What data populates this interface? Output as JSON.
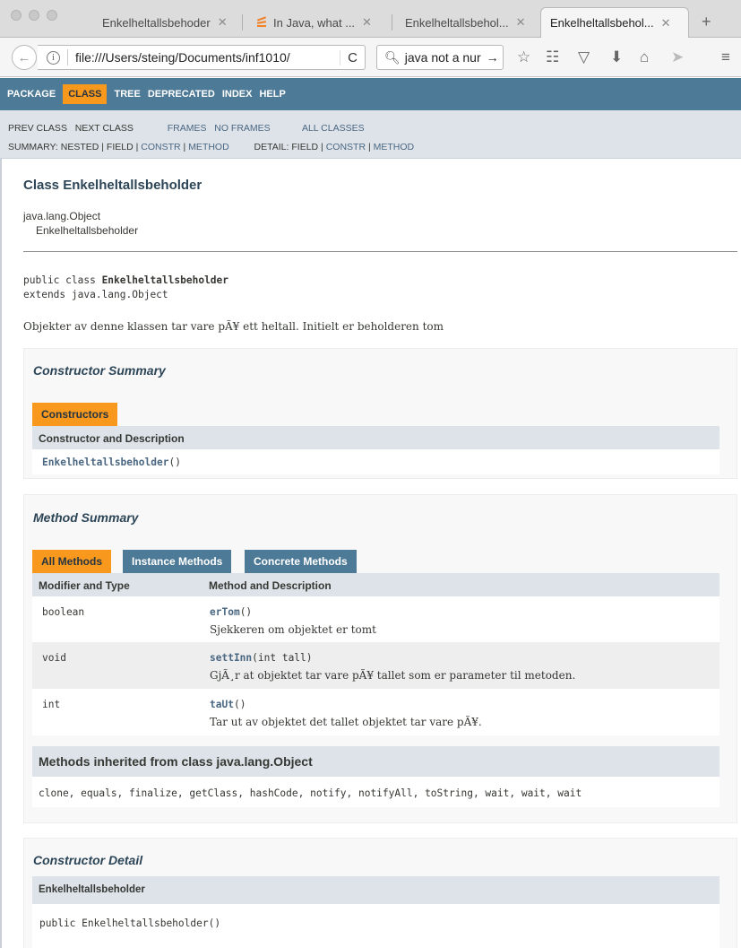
{
  "browser": {
    "tabs": [
      {
        "label": "Enkelheltallsbehoder",
        "close": "✕"
      },
      {
        "label": "In Java, what ...",
        "close": "✕"
      },
      {
        "label": "Enkelheltallsbehol...",
        "close": "✕"
      },
      {
        "label": "Enkelheltallsbehol...",
        "close": "✕"
      }
    ],
    "new_tab": "+",
    "url": "file:///Users/steing/Documents/inf1010/",
    "reload": "C",
    "search_value": "java not a nur",
    "search_go": "→"
  },
  "javadoc": {
    "topnav": [
      "PACKAGE",
      "CLASS",
      "TREE",
      "DEPRECATED",
      "INDEX",
      "HELP"
    ],
    "subnav": {
      "prev_class": "PREV CLASS",
      "next_class": "NEXT CLASS",
      "frames": "FRAMES",
      "no_frames": "NO FRAMES",
      "all_classes": "ALL CLASSES",
      "summary_label": "SUMMARY:",
      "summary_nested": "NESTED",
      "summary_field": "FIELD",
      "summary_constr": "CONSTR",
      "summary_method": "METHOD",
      "detail_label": "DETAIL:",
      "detail_field": "FIELD",
      "detail_constr": "CONSTR",
      "detail_method": "METHOD",
      "sep": "|"
    },
    "class_title": "Class Enkelheltallsbeholder",
    "inheritance": [
      "java.lang.Object",
      "Enkelheltallsbeholder"
    ],
    "signature_prefix": "public class ",
    "signature_name": "Enkelheltallsbeholder",
    "signature_extends": "extends java.lang.Object",
    "description": "Objekter av denne klassen tar vare pÃ¥ ett heltall. Initielt er beholderen tom",
    "constructor_summary": {
      "title": "Constructor Summary",
      "caption": "Constructors",
      "header": "Constructor and Description",
      "rows": [
        {
          "name": "Enkelheltallsbeholder",
          "params": "()"
        }
      ]
    },
    "method_summary": {
      "title": "Method Summary",
      "tabs": [
        "All Methods",
        "Instance Methods",
        "Concrete Methods"
      ],
      "col_modifier": "Modifier and Type",
      "col_method": "Method and Description",
      "rows": [
        {
          "type": "boolean",
          "name": "erTom",
          "params": "()",
          "desc": "Sjekkeren om objektet er tomt"
        },
        {
          "type": "void",
          "name": "settInn",
          "params": "(int tall)",
          "desc": "GjÃ¸r at objektet tar vare pÃ¥ tallet som er parameter til metoden."
        },
        {
          "type": "int",
          "name": "taUt",
          "params": "()",
          "desc": "Tar ut av objektet det tallet objektet tar vare pÃ¥."
        }
      ],
      "inherited_title": "Methods inherited from class java.lang.Object",
      "inherited_list": "clone, equals, finalize, getClass, hashCode, notify, notifyAll, toString, wait, wait, wait"
    },
    "constructor_detail": {
      "title": "Constructor Detail",
      "name": "Enkelheltallsbeholder",
      "signature": "public Enkelheltallsbeholder()"
    }
  }
}
